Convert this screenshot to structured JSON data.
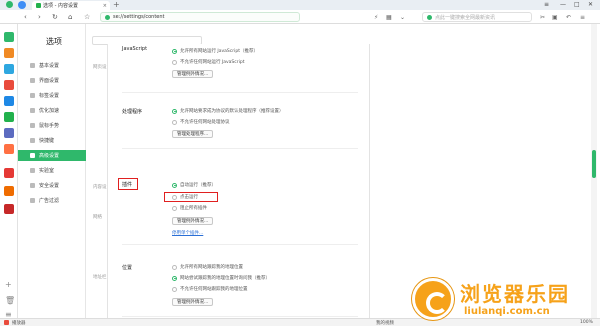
{
  "tab": {
    "title": "选项 - 内容设置",
    "close": "×",
    "new": "+"
  },
  "window": {
    "minimize": "—",
    "maximize": "□",
    "close": "✕"
  },
  "nav": {
    "back": "‹",
    "forward": "›",
    "reload": "↻",
    "home": "⌂",
    "star": "☆",
    "url": "se://settings/content",
    "search_placeholder": "点此一键搜索全网最新资讯"
  },
  "sidebar": {
    "title": "选项",
    "items": [
      {
        "label": "基本设置",
        "icon": "home-icon"
      },
      {
        "label": "界面设置",
        "icon": "layout-icon"
      },
      {
        "label": "标签设置",
        "icon": "tab-icon"
      },
      {
        "label": "优化加速",
        "icon": "speed-icon"
      },
      {
        "label": "鼠标手势",
        "icon": "gesture-icon"
      },
      {
        "label": "快捷键",
        "icon": "keyboard-icon"
      },
      {
        "label": "高级设置",
        "icon": "advanced-icon",
        "active": true
      },
      {
        "label": "实验室",
        "icon": "lab-icon"
      },
      {
        "label": "安全设置",
        "icon": "shield-icon"
      },
      {
        "label": "广告过滤",
        "icon": "adblock-icon"
      }
    ]
  },
  "content": {
    "groups": [
      "网页设",
      "内容设",
      "网络",
      "地址栏"
    ],
    "sections": {
      "javascript": {
        "header": "JavaScript",
        "opt1": "允许所有网站运行 JavaScript（推荐）",
        "opt2": "不允许任何网站运行 JavaScript",
        "button": "管理例外情况..."
      },
      "handlers": {
        "header": "处理程序",
        "opt1": "允许网站要求成为协议的默认处理程序（推荐设置）",
        "opt2": "不允许任何网站处理协议",
        "button": "管理处理程序..."
      },
      "plugins": {
        "header": "插件",
        "opt1": "自动运行（推荐）",
        "opt2": "点击运行",
        "opt3": "阻止所有插件",
        "button": "管理例外情况...",
        "link": "停用单个插件..."
      },
      "location": {
        "header": "位置",
        "opt1": "允许所有网站跟踪我的地理位置",
        "opt2": "网站尝试跟踪我的地理位置时询问我（推荐）",
        "opt3": "不允许任何网站跟踪我的地理位置",
        "button": "管理例外情况..."
      }
    }
  },
  "status": {
    "left": "播放器",
    "right1": "我的视频",
    "zoom": "100%"
  },
  "watermark": {
    "cn": "浏览器乐园",
    "en": "liulanqi.com.cn"
  },
  "colors": {
    "accent": "#2fb86b",
    "highlight": "#e02020",
    "watermark": "#f6a21a"
  }
}
